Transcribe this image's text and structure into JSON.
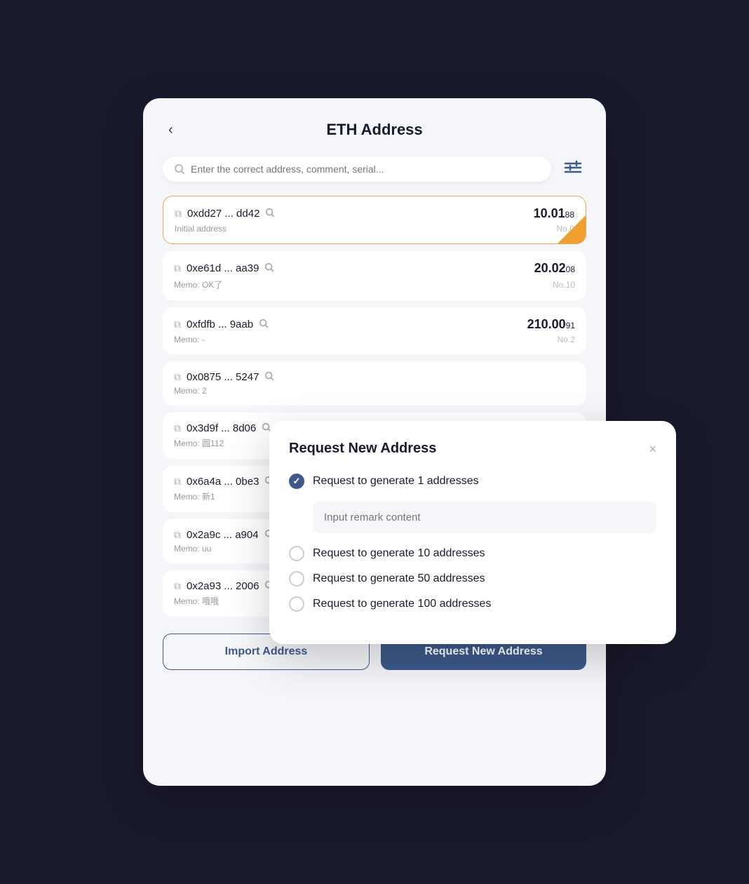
{
  "header": {
    "back_label": "‹",
    "title": "ETH Address"
  },
  "search": {
    "placeholder": "Enter the correct address, comment, serial..."
  },
  "addresses": [
    {
      "address": "0xdd27 ... dd42",
      "memo": "Initial address",
      "amount_main": "10.01",
      "amount_decimal": "88",
      "no": "No.0",
      "active": true
    },
    {
      "address": "0xe61d ... aa39",
      "memo": "Memo: OK了",
      "amount_main": "20.02",
      "amount_decimal": "08",
      "no": "No.10",
      "active": false
    },
    {
      "address": "0xfdfb ... 9aab",
      "memo": "Memo: -",
      "amount_main": "210.00",
      "amount_decimal": "91",
      "no": "No.2",
      "active": false
    },
    {
      "address": "0x0875 ... 5247",
      "memo": "Memo: 2",
      "amount_main": "",
      "amount_decimal": "",
      "no": "",
      "active": false
    },
    {
      "address": "0x3d9f ... 8d06",
      "memo": "Memo: 圆112",
      "amount_main": "",
      "amount_decimal": "",
      "no": "",
      "active": false
    },
    {
      "address": "0x6a4a ... 0be3",
      "memo": "Memo: 新1",
      "amount_main": "",
      "amount_decimal": "",
      "no": "",
      "active": false
    },
    {
      "address": "0x2a9c ... a904",
      "memo": "Memo: uu",
      "amount_main": "",
      "amount_decimal": "",
      "no": "",
      "active": false
    },
    {
      "address": "0x2a93 ... 2006",
      "memo": "Memo: 哦哦",
      "amount_main": "",
      "amount_decimal": "",
      "no": "",
      "active": false
    }
  ],
  "buttons": {
    "import_label": "Import Address",
    "request_label": "Request New Address"
  },
  "modal": {
    "title": "Request New Address",
    "close_label": "×",
    "remark_placeholder": "Input remark content",
    "options": [
      {
        "label": "Request to generate 1 addresses",
        "checked": true
      },
      {
        "label": "Request to generate 10 addresses",
        "checked": false
      },
      {
        "label": "Request to generate 50 addresses",
        "checked": false
      },
      {
        "label": "Request to generate 100 addresses",
        "checked": false
      }
    ]
  }
}
